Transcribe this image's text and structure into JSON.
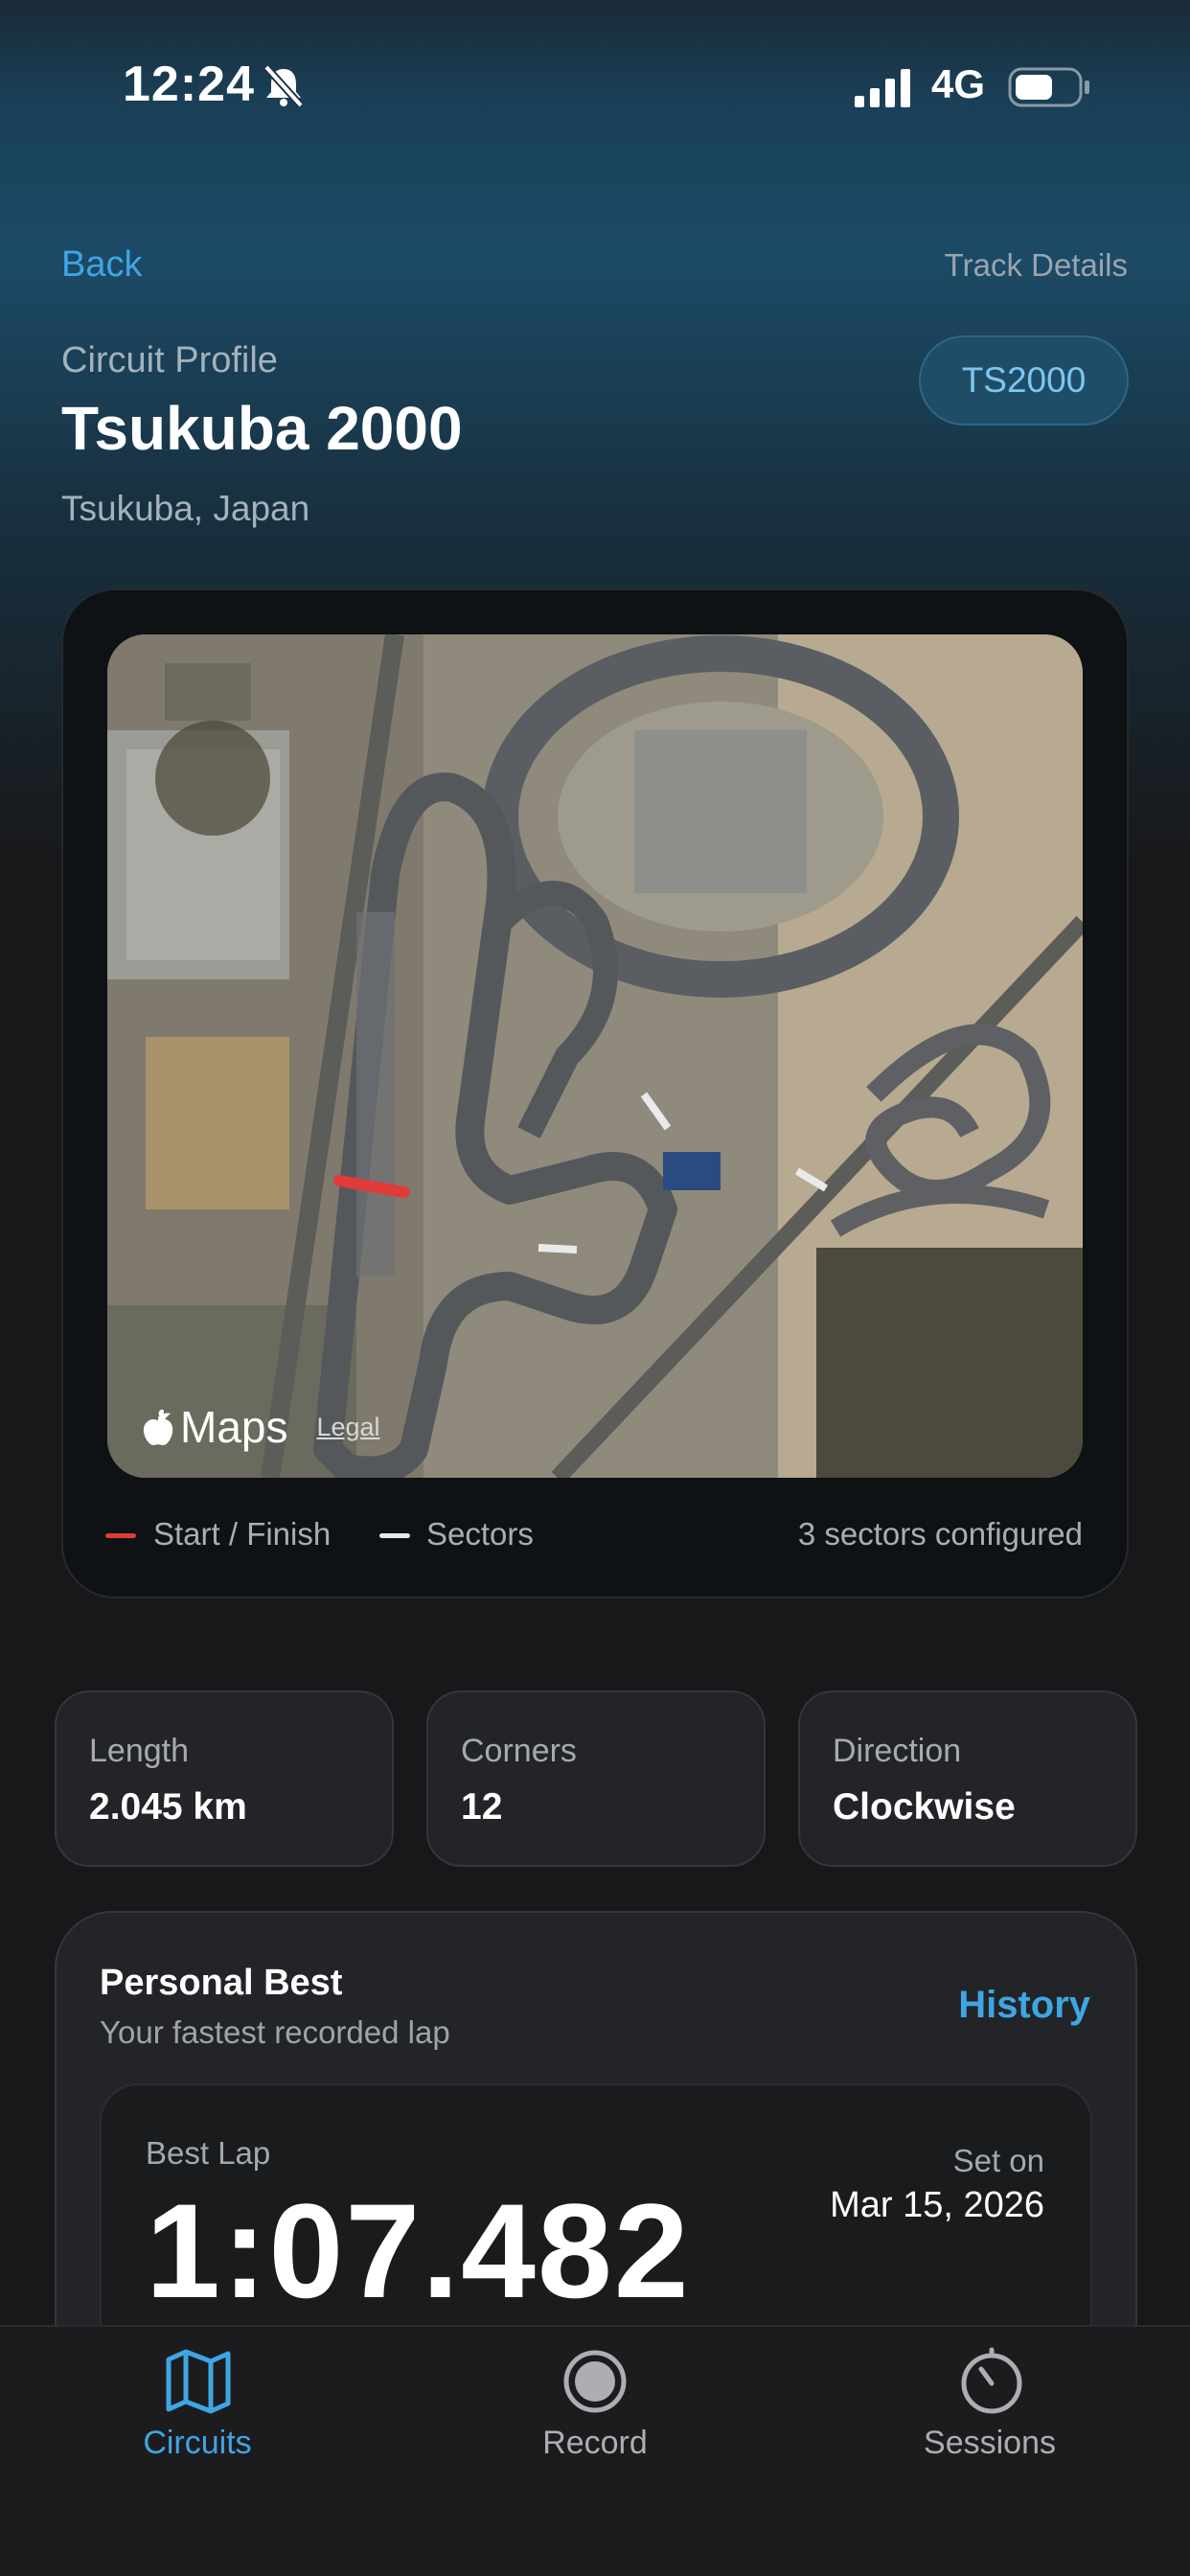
{
  "status_bar": {
    "time": "12:24",
    "network": "4G"
  },
  "header": {
    "back_label": "Back",
    "title_right": "Track Details",
    "eyebrow": "Circuit Profile",
    "track_name": "Tsukuba 2000",
    "location": "Tsukuba, Japan",
    "code_badge": "TS2000"
  },
  "map_card": {
    "attribution": "Maps",
    "legal_label": "Legal",
    "legend": [
      {
        "label": "Start / Finish",
        "color": "#e03b3b"
      },
      {
        "label": "Sectors",
        "color": "#e8e8e8"
      }
    ],
    "sectors_summary": "3 sectors configured"
  },
  "stats": [
    {
      "label": "Length",
      "value": "2.045 km"
    },
    {
      "label": "Corners",
      "value": "12"
    },
    {
      "label": "Direction",
      "value": "Clockwise"
    }
  ],
  "personal_best": {
    "title": "Personal Best",
    "subtitle": "Your fastest recorded lap",
    "history_label": "History",
    "best_lap_label": "Best Lap",
    "best_lap_time": "1:07.482",
    "set_on_label": "Set on",
    "set_on_date": "Mar 15, 2026"
  },
  "tab_bar": {
    "tabs": [
      {
        "label": "Circuits",
        "icon": "map-icon",
        "active": true
      },
      {
        "label": "Record",
        "icon": "record-icon",
        "active": false
      },
      {
        "label": "Sessions",
        "icon": "stopwatch-icon",
        "active": false
      }
    ]
  },
  "colors": {
    "accent": "#3ea6e3",
    "start_finish": "#e03b3b",
    "background": "#18181a"
  }
}
